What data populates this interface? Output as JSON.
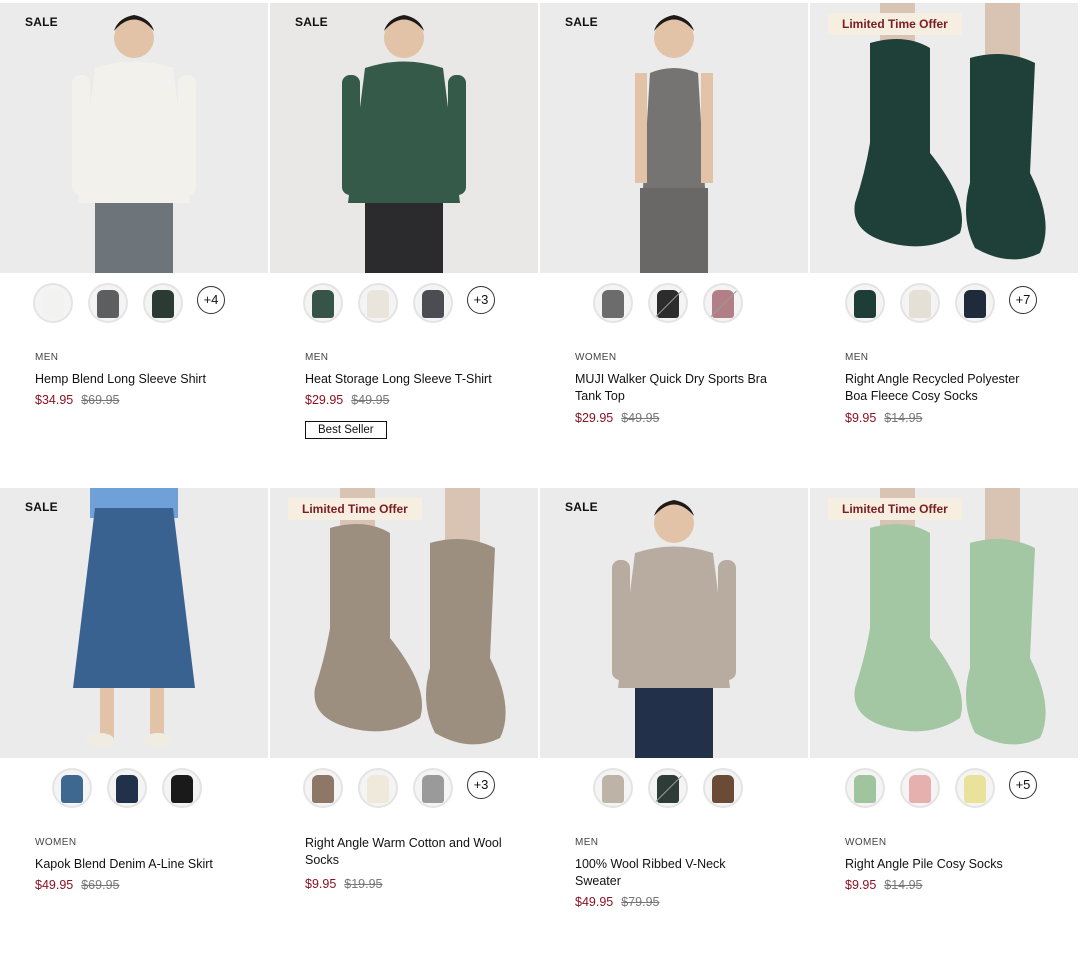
{
  "products": [
    {
      "badge": "SALE",
      "badge_type": "sale",
      "gender": "MEN",
      "name": "Hemp Blend Long Sleeve Shirt",
      "price": "$34.95",
      "was": "$69.95",
      "more": "+4",
      "swatch_colors": [
        "#f2f2f0",
        "#5c5e5f",
        "#2c3a34"
      ],
      "photo": {
        "bg": "#ebebeb",
        "top": "#f3f1ec",
        "bottom": "#6d747a",
        "kind": "person"
      }
    },
    {
      "badge": "SALE",
      "badge_type": "sale",
      "gender": "MEN",
      "name": "Heat Storage Long Sleeve T-Shirt",
      "price": "$29.95",
      "was": "$49.95",
      "more": "+3",
      "extra": "Best Seller",
      "swatch_colors": [
        "#365548",
        "#e9e5dc",
        "#4b4d52"
      ],
      "photo": {
        "bg": "#e9e8e6",
        "top": "#355a4a",
        "bottom": "#2b2b2e",
        "kind": "person"
      }
    },
    {
      "badge": "SALE",
      "badge_type": "sale",
      "gender": "WOMEN",
      "name": "MUJI Walker Quick Dry Sports Bra Tank Top",
      "price": "$29.95",
      "was": "$49.95",
      "more": "",
      "swatch_colors": [
        "#6c6c6c",
        "#2c2c2c",
        "#b37f86"
      ],
      "photo": {
        "bg": "#ebebeb",
        "top": "#757473",
        "bottom": "#6a6867",
        "kind": "tank"
      }
    },
    {
      "badge": "Limited Time Offer",
      "badge_type": "lto",
      "gender": "MEN",
      "name": "Right Angle Recycled Polyester Boa Fleece Cosy Socks",
      "price": "$9.95",
      "was": "$14.95",
      "more": "+7",
      "swatch_colors": [
        "#1f3d37",
        "#e4e0d6",
        "#1f2a3a"
      ],
      "photo": {
        "bg": "#ececec",
        "top": "#1f3f39",
        "bottom": "#1f3f39",
        "kind": "socks"
      }
    },
    {
      "badge": "SALE",
      "badge_type": "sale",
      "gender": "WOMEN",
      "name": "Kapok Blend Denim A-Line Skirt",
      "price": "$49.95",
      "was": "$69.95",
      "more": "",
      "swatch_colors": [
        "#3f6890",
        "#22314a",
        "#1a1a1a"
      ],
      "photo": {
        "bg": "#ebebeb",
        "top": "#6fa0d8",
        "bottom": "#3a6290",
        "kind": "skirt"
      }
    },
    {
      "badge": "Limited Time Offer",
      "badge_type": "lto",
      "gender": "",
      "name": "Right Angle Warm Cotton and Wool Socks",
      "price": "$9.95",
      "was": "$19.95",
      "more": "+3",
      "swatch_colors": [
        "#8d7766",
        "#efe9dc",
        "#9a9a9a"
      ],
      "photo": {
        "bg": "#ebebeb",
        "top": "#9d8f80",
        "bottom": "#9d8f80",
        "kind": "socks"
      }
    },
    {
      "badge": "SALE",
      "badge_type": "sale",
      "gender": "MEN",
      "name": "100% Wool Ribbed V-Neck Sweater",
      "price": "$49.95",
      "was": "$79.95",
      "more": "",
      "swatch_colors": [
        "#bdb3a6",
        "#2e3c37",
        "#6b4a36"
      ],
      "photo": {
        "bg": "#ebebeb",
        "top": "#b8aca0",
        "bottom": "#22304a",
        "kind": "person"
      }
    },
    {
      "badge": "Limited Time Offer",
      "badge_type": "lto",
      "gender": "WOMEN",
      "name": "Right Angle Pile Cosy Socks",
      "price": "$9.95",
      "was": "$14.95",
      "more": "+5",
      "swatch_colors": [
        "#9fc49e",
        "#e5b0ae",
        "#e9e29a"
      ],
      "photo": {
        "bg": "#ececec",
        "top": "#a3c7a2",
        "bottom": "#a3c7a2",
        "kind": "socks"
      }
    }
  ]
}
